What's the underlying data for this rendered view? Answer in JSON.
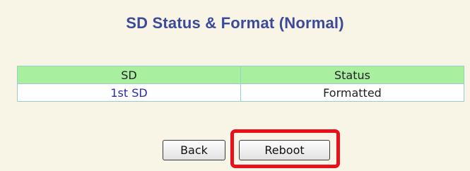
{
  "page": {
    "title": "SD Status & Format (Normal)"
  },
  "table": {
    "headers": [
      "SD",
      "Status"
    ],
    "rows": [
      {
        "sd": "1st SD",
        "status": "Formatted"
      }
    ]
  },
  "buttons": {
    "back_label": "Back",
    "reboot_label": "Reboot"
  },
  "colors": {
    "background": "#f8f5e6",
    "title": "#3b4a9a",
    "header_bg": "#a8f0a0",
    "sd_link": "#2a2ab0",
    "highlight": "#e8101a"
  }
}
